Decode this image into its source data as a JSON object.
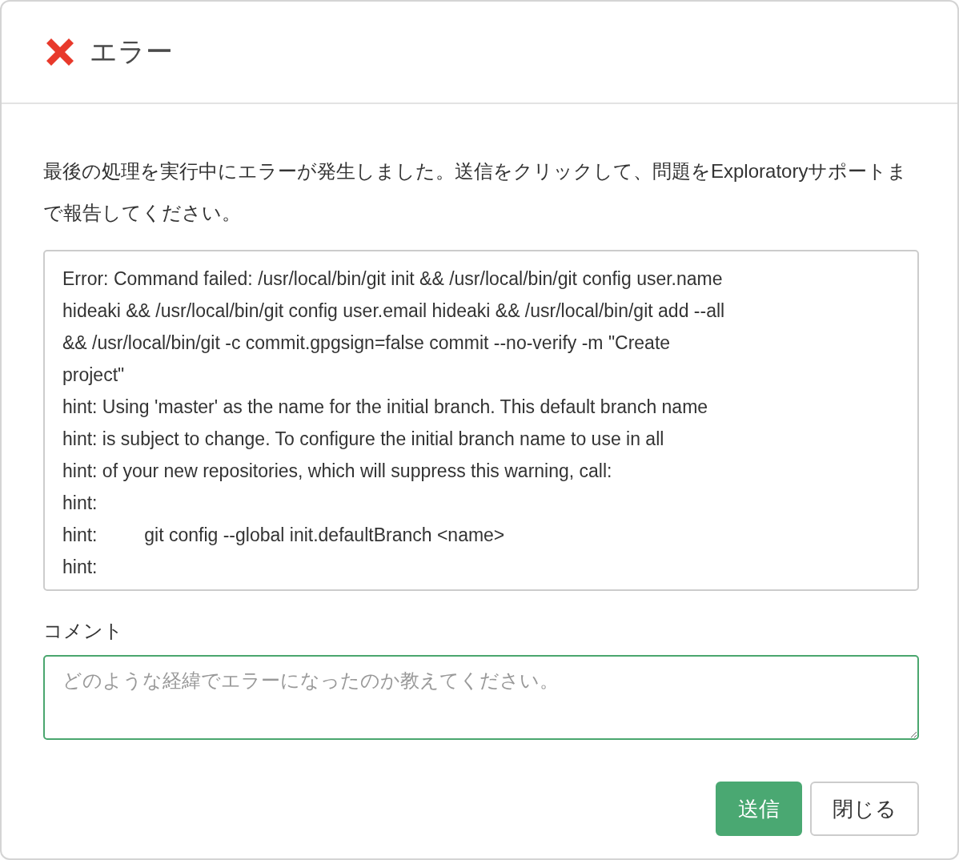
{
  "dialog": {
    "title": "エラー",
    "message": "最後の処理を実行中にエラーが発生しました。送信をクリックして、問題をExploratoryサポートまで報告してください。",
    "error_log": "Error: Command failed: /usr/local/bin/git init && /usr/local/bin/git config user.name\nhideaki && /usr/local/bin/git config user.email hideaki && /usr/local/bin/git add --all\n&& /usr/local/bin/git -c commit.gpgsign=false commit --no-verify -m \"Create\nproject\"\nhint: Using 'master' as the name for the initial branch. This default branch name\nhint: is subject to change. To configure the initial branch name to use in all\nhint: of your new repositories, which will suppress this warning, call:\nhint:\nhint: \tgit config --global init.defaultBranch <name>\nhint:",
    "comment": {
      "label": "コメント",
      "placeholder": "どのような経緯でエラーになったのか教えてください。"
    },
    "buttons": [
      {
        "label": "送信",
        "kind": "primary"
      },
      {
        "label": "閉じる",
        "kind": "default"
      }
    ]
  }
}
